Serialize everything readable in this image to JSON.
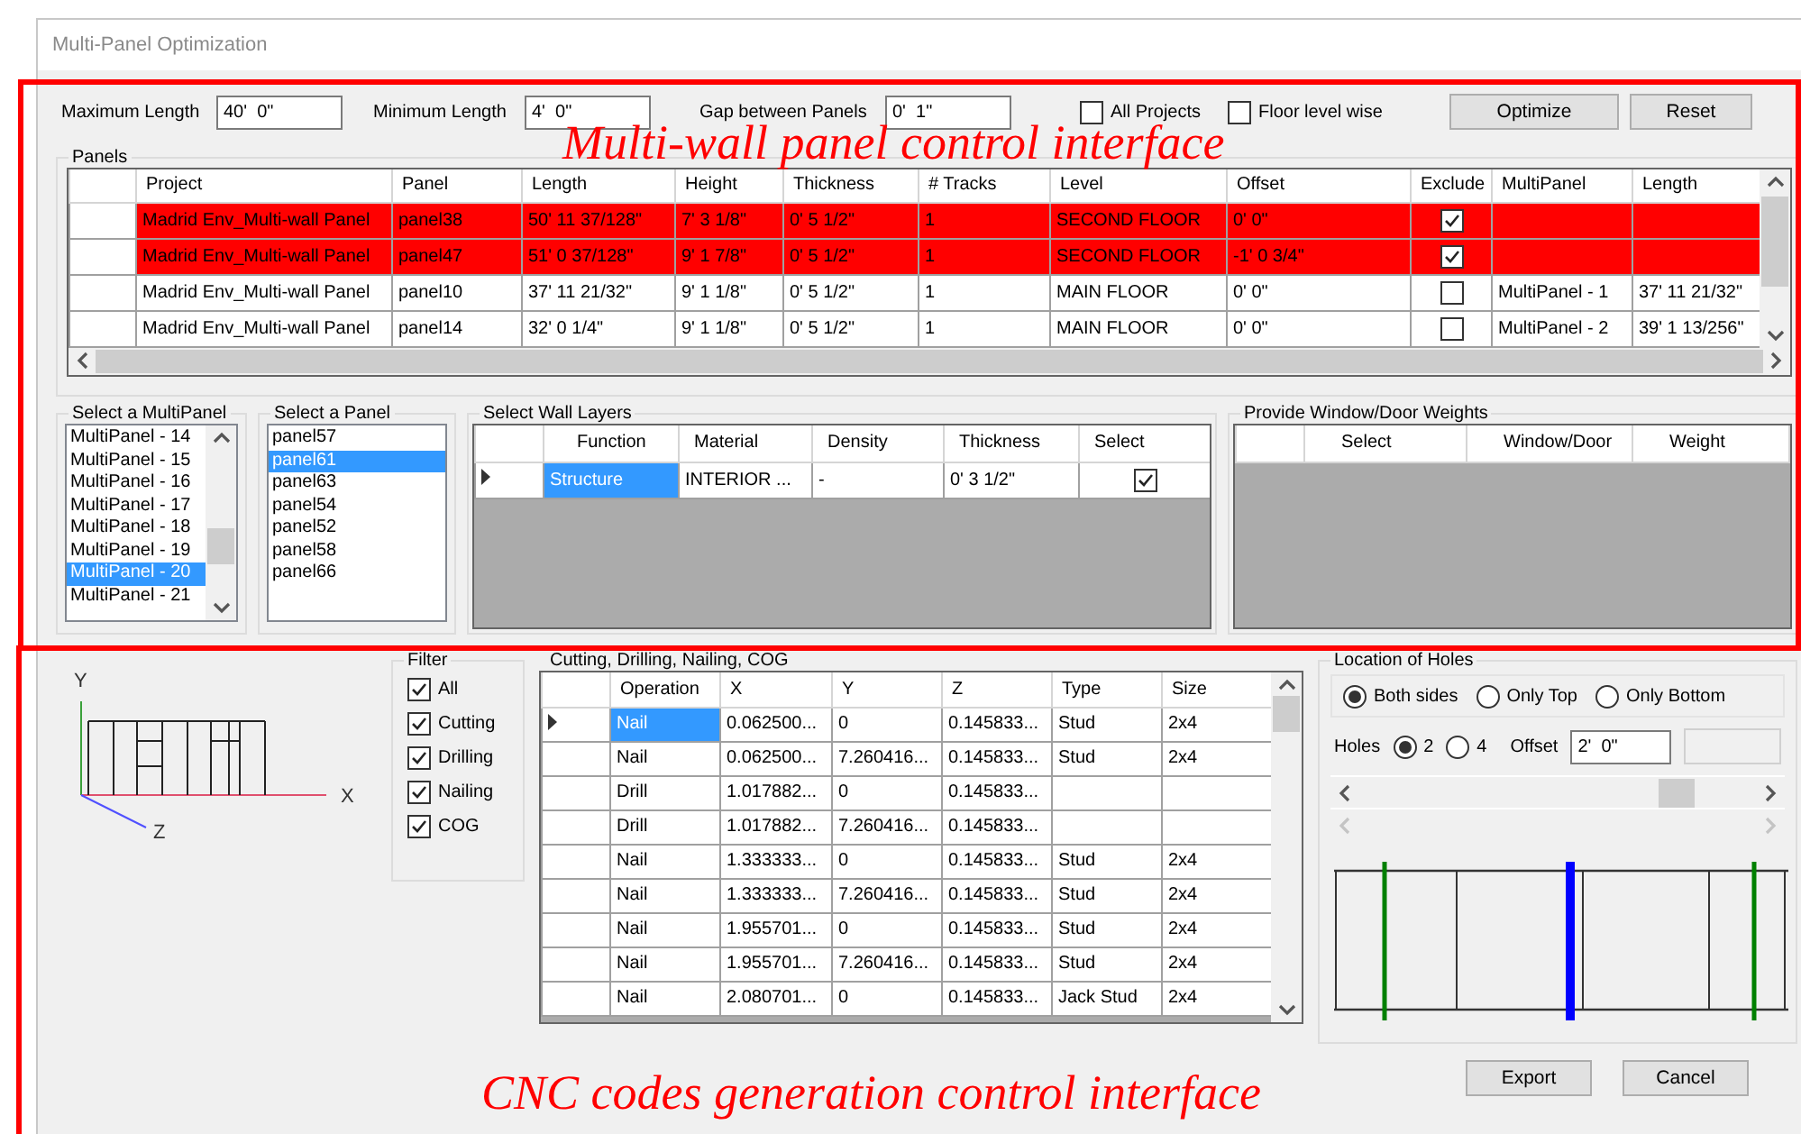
{
  "window": {
    "title": "Multi-Panel Optimization"
  },
  "settings": {
    "fields": [
      {
        "label": "Maximum Length",
        "value": "40'  0\""
      },
      {
        "label": "Minimum Length",
        "value": "4'  0\""
      },
      {
        "label": "Gap between Panels",
        "value": "0'  1\""
      }
    ],
    "checkboxes": [
      {
        "label": "All Projects",
        "checked": false
      },
      {
        "label": "Floor level wise",
        "checked": false
      }
    ],
    "buttons": [
      "Optimize",
      "Reset"
    ]
  },
  "panels": {
    "title": "Panels",
    "columns": [
      "Project",
      "Panel",
      "Length",
      "Height",
      "Thickness",
      "# Tracks",
      "Level",
      "Offset",
      "Exclude",
      "MultiPanel",
      "Length"
    ],
    "rows": [
      {
        "flagged": true,
        "exclude": true,
        "cells": [
          "Madrid Env_Multi-wall Panel",
          "panel38",
          "50'  11 37/128\"",
          "7'  3 1/8\"",
          "0'  5 1/2\"",
          "1",
          "SECOND FLOOR",
          "0'  0\""
        ]
      },
      {
        "flagged": true,
        "exclude": true,
        "cells": [
          "Madrid Env_Multi-wall Panel",
          "panel47",
          "51'  0 37/128\"",
          "9'  1 7/8\"",
          "0'  5 1/2\"",
          "1",
          "SECOND FLOOR",
          "-1'  0 3/4\""
        ]
      },
      {
        "flagged": false,
        "exclude": false,
        "cells": [
          "Madrid Env_Multi-wall Panel",
          "panel10",
          "37'  11 21/32\"",
          "9'  1 1/8\"",
          "0'  5 1/2\"",
          "1",
          "MAIN FLOOR",
          "0'  0\""
        ],
        "multipanel": "MultiPanel - 1",
        "multipanel_length": "37'  11 21/32\""
      },
      {
        "flagged": false,
        "exclude": false,
        "cells": [
          "Madrid Env_Multi-wall Panel",
          "panel14",
          "32'  0 1/4\"",
          "9'  1 1/8\"",
          "0'  5 1/2\"",
          "1",
          "MAIN FLOOR",
          "0'  0\""
        ],
        "multipanel": "MultiPanel - 2",
        "multipanel_length": "39'  1 13/256\""
      }
    ]
  },
  "multipanel_list": {
    "title": "Select a MultiPanel",
    "items": [
      {
        "label": "MultiPanel - 14",
        "selected": false
      },
      {
        "label": "MultiPanel - 15",
        "selected": false
      },
      {
        "label": "MultiPanel - 16",
        "selected": false
      },
      {
        "label": "MultiPanel - 17",
        "selected": false
      },
      {
        "label": "MultiPanel - 18",
        "selected": false
      },
      {
        "label": "MultiPanel - 19",
        "selected": false
      },
      {
        "label": "MultiPanel - 20",
        "selected": true
      },
      {
        "label": "MultiPanel - 21",
        "selected": false
      }
    ]
  },
  "panel_list": {
    "title": "Select a Panel",
    "items": [
      {
        "label": "panel57",
        "selected": false
      },
      {
        "label": "panel61",
        "selected": true
      },
      {
        "label": "panel63",
        "selected": false
      },
      {
        "label": "panel54",
        "selected": false
      },
      {
        "label": "panel52",
        "selected": false
      },
      {
        "label": "panel58",
        "selected": false
      },
      {
        "label": "panel66",
        "selected": false
      }
    ]
  },
  "wall_layers": {
    "title": "Select Wall Layers",
    "columns": [
      "Function",
      "Material",
      "Density",
      "Thickness",
      "Select"
    ],
    "rows": [
      {
        "current": true,
        "select": true,
        "cells": [
          "Structure",
          "INTERIOR ...",
          "-",
          "0'  3 1/2\""
        ]
      }
    ]
  },
  "weights": {
    "title": "Provide Window/Door Weights",
    "columns": [
      "Select",
      "Window/Door",
      "Weight"
    ]
  },
  "axes": {
    "labels": [
      "Y",
      "X",
      "Z"
    ]
  },
  "filter": {
    "title": "Filter",
    "options": [
      {
        "label": "All",
        "checked": true
      },
      {
        "label": "Cutting",
        "checked": true
      },
      {
        "label": "Drilling",
        "checked": true
      },
      {
        "label": "Nailing",
        "checked": true
      },
      {
        "label": "COG",
        "checked": true
      }
    ]
  },
  "operations": {
    "title": "Cutting, Drilling, Nailing, COG",
    "columns": [
      "Operation",
      "X",
      "Y",
      "Z",
      "Type",
      "Size"
    ],
    "rows": [
      {
        "current": true,
        "cells": [
          "Nail",
          "0.062500...",
          "0",
          "0.145833...",
          "Stud",
          "2x4"
        ]
      },
      {
        "current": false,
        "cells": [
          "Nail",
          "0.062500...",
          "7.260416...",
          "0.145833...",
          "Stud",
          "2x4"
        ]
      },
      {
        "current": false,
        "cells": [
          "Drill",
          "1.017882...",
          "0",
          "0.145833..."
        ]
      },
      {
        "current": false,
        "cells": [
          "Drill",
          "1.017882...",
          "7.260416...",
          "0.145833..."
        ]
      },
      {
        "current": false,
        "cells": [
          "Nail",
          "1.333333...",
          "0",
          "0.145833...",
          "Stud",
          "2x4"
        ]
      },
      {
        "current": false,
        "cells": [
          "Nail",
          "1.333333...",
          "7.260416...",
          "0.145833...",
          "Stud",
          "2x4"
        ]
      },
      {
        "current": false,
        "cells": [
          "Nail",
          "1.955701...",
          "0",
          "0.145833...",
          "Stud",
          "2x4"
        ]
      },
      {
        "current": false,
        "cells": [
          "Nail",
          "1.955701...",
          "7.260416...",
          "0.145833...",
          "Stud",
          "2x4"
        ]
      },
      {
        "current": false,
        "cells": [
          "Nail",
          "2.080701...",
          "0",
          "0.145833...",
          "Jack Stud",
          "2x4"
        ]
      }
    ]
  },
  "holes": {
    "title": "Location of Holes",
    "sides": [
      {
        "label": "Both sides",
        "selected": true
      },
      {
        "label": "Only Top",
        "selected": false
      },
      {
        "label": "Only Bottom",
        "selected": false
      }
    ],
    "count_label": "Holes",
    "counts": [
      {
        "label": "2",
        "selected": true
      },
      {
        "label": "4",
        "selected": false
      }
    ],
    "offset_label": "Offset",
    "offset_value": "2'  0\""
  },
  "buttons": [
    "Export",
    "Cancel"
  ],
  "annotations": [
    {
      "text": "Multi-wall panel control interface"
    },
    {
      "text": "CNC codes generation control interface"
    }
  ]
}
